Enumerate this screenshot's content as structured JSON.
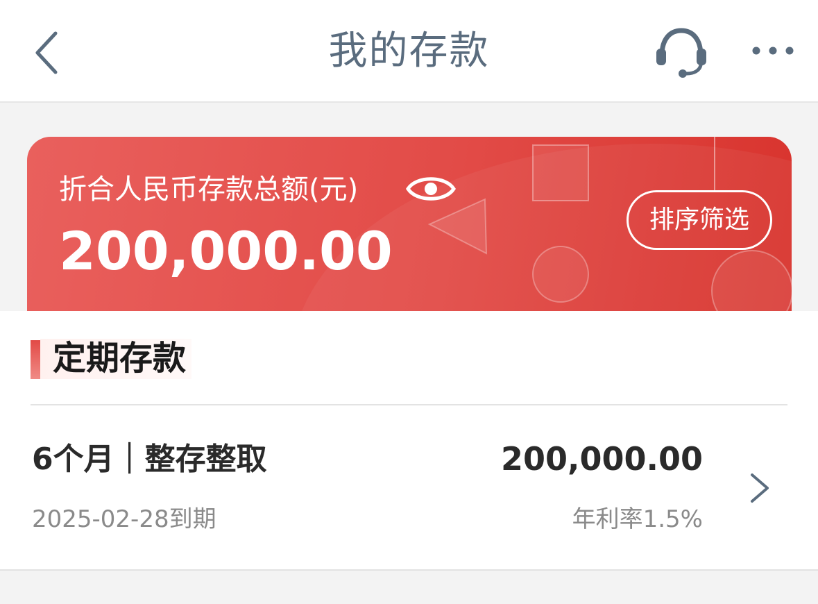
{
  "header": {
    "title": "我的存款",
    "back_icon": "chevron-left-icon",
    "service_icon": "headset-icon",
    "more_icon": "more-dots-icon"
  },
  "summary_card": {
    "label": "折合人民币存款总额(元)",
    "total_amount": "200,000.00",
    "visibility_icon": "eye-icon",
    "filter_button": "排序筛选",
    "accent_color": "#e24b47"
  },
  "section": {
    "title": "定期存款",
    "deposits": [
      {
        "term": "6个月｜整存整取",
        "amount": "200,000.00",
        "maturity": "2025-02-28到期",
        "rate": "年利率1.5%"
      }
    ]
  }
}
